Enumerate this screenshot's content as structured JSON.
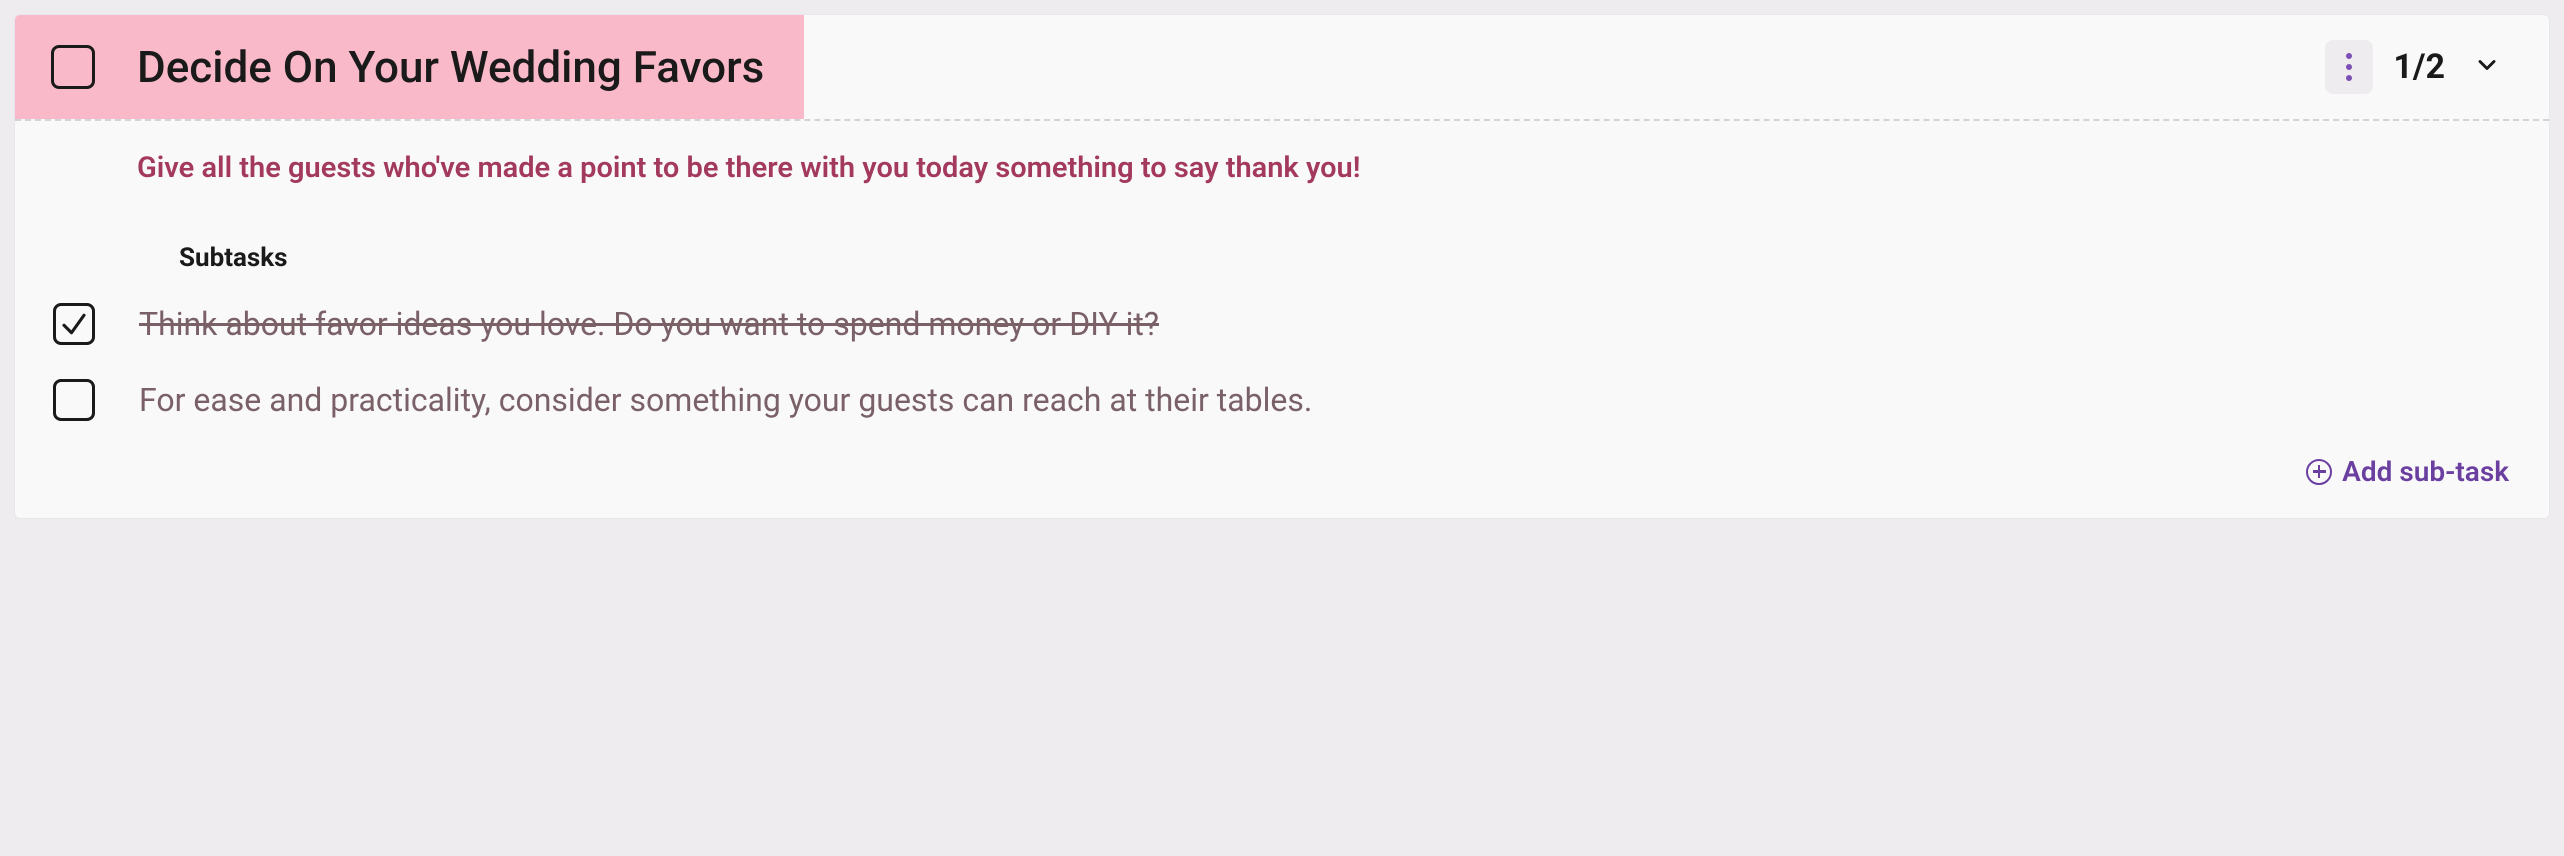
{
  "task": {
    "title": "Decide On Your Wedding Favors",
    "description": "Give all the guests who've made a point to be there with you today something to say thank you!",
    "progress": "1/2",
    "completed": false
  },
  "subtasks": {
    "label": "Subtasks",
    "items": [
      {
        "text": "Think about favor ideas you love. Do you want to spend money or DIY it?",
        "completed": true
      },
      {
        "text": "For ease and practicality, consider something your guests can reach at their tables.",
        "completed": false
      }
    ]
  },
  "actions": {
    "addSubtask": "Add sub-task"
  }
}
